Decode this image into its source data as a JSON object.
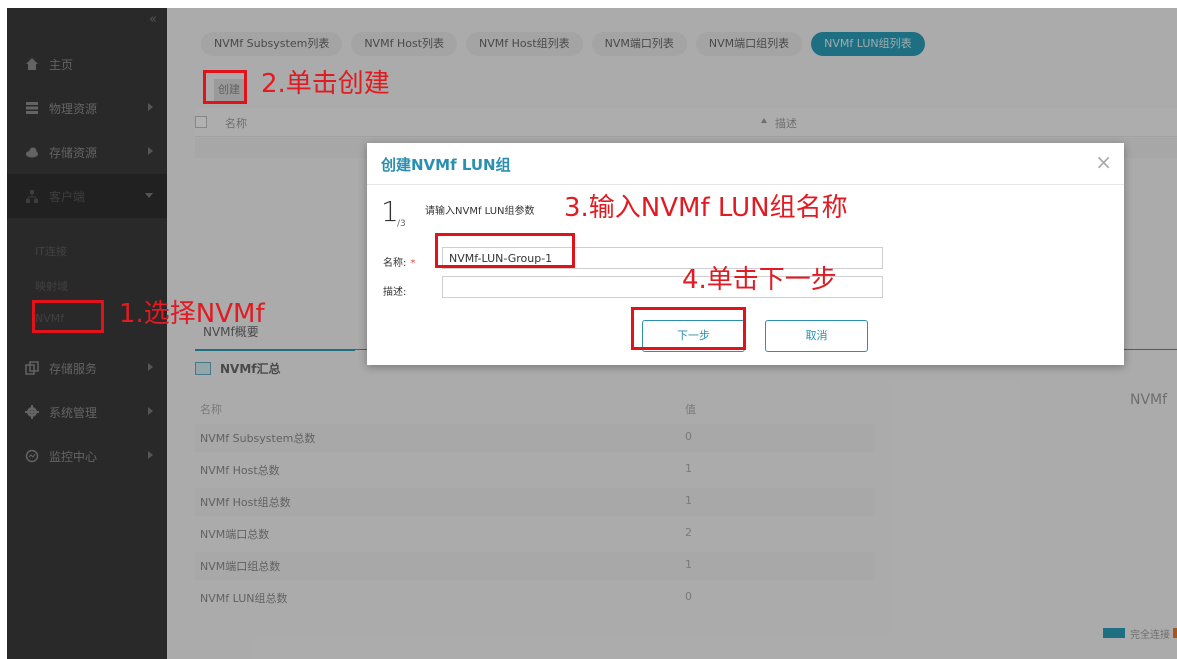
{
  "sidebar": {
    "collapse_icon": "«",
    "items": [
      {
        "label": "主页",
        "icon": "home-icon"
      },
      {
        "label": "物理资源",
        "icon": "server-icon"
      },
      {
        "label": "存储资源",
        "icon": "cloud-icon"
      },
      {
        "label": "客户端",
        "icon": "network-icon"
      },
      {
        "label": "存储服务",
        "icon": "copy-icon"
      },
      {
        "label": "系统管理",
        "icon": "gear-icon"
      },
      {
        "label": "监控中心",
        "icon": "monitor-icon"
      }
    ],
    "sub_items": [
      "IT连接",
      "映射域",
      "NVMf"
    ]
  },
  "tabs": [
    "NVMf Subsystem列表",
    "NVMf Host列表",
    "NVMf Host组列表",
    "NVM端口列表",
    "NVM端口组列表",
    "NVMf LUN组列表"
  ],
  "active_tab": "NVMf LUN组列表",
  "toolbar": {
    "create_label": "创建"
  },
  "list": {
    "col_name": "名称",
    "col_desc": "描述"
  },
  "summary": {
    "tab_label": "NVMf概要",
    "title": "NVMf汇总",
    "head_name": "名称",
    "head_value": "值",
    "rows": [
      {
        "label": "NVMf Subsystem总数",
        "value": "0"
      },
      {
        "label": "NVMf Host总数",
        "value": "1"
      },
      {
        "label": "NVMf Host组总数",
        "value": "1"
      },
      {
        "label": "NVM端口总数",
        "value": "2"
      },
      {
        "label": "NVM端口组总数",
        "value": "1"
      },
      {
        "label": "NVMf LUN组总数",
        "value": "0"
      }
    ],
    "right_title": "NVMf",
    "legend": {
      "label": "完全连接",
      "color_a": "#2b9ab5",
      "color_b": "#e07a2e"
    }
  },
  "modal": {
    "title": "创建NVMf LUN组",
    "close": "×",
    "step": "1",
    "step_total": "/3",
    "step_text": "请输入NVMf LUN组参数",
    "name_label": "名称:",
    "name_required": "*",
    "name_value": "NVMf-LUN-Group-1",
    "desc_label": "描述:",
    "desc_value": "",
    "next_label": "下一步",
    "cancel_label": "取消"
  },
  "annotations": {
    "step1": "1.选择NVMf",
    "step2": "2.单击创建",
    "step3": "3.输入NVMf LUN组名称",
    "step4": "4.单击下一步",
    "color": "#e0131b"
  }
}
